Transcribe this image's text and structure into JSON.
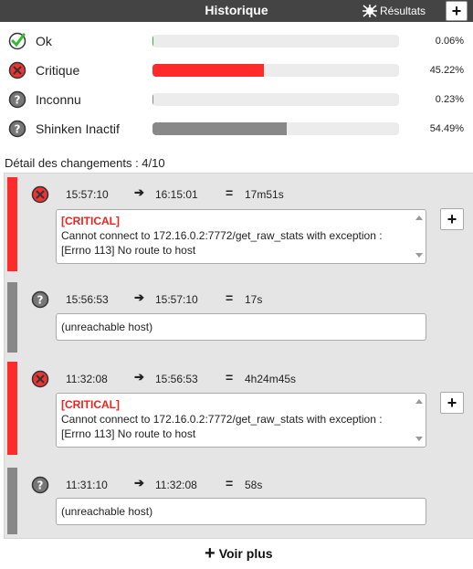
{
  "header": {
    "title": "Historique",
    "results_label": "Résultats",
    "plus_label": "+"
  },
  "stats": [
    {
      "label": "Ok",
      "percent": "0.06%",
      "fraction": 0.0006,
      "color": "#2fbd2f",
      "icon": "check-icon"
    },
    {
      "label": "Critique",
      "percent": "45.22%",
      "fraction": 0.4522,
      "color": "#ff2b2b",
      "icon": "critical-icon"
    },
    {
      "label": "Inconnu",
      "percent": "0.23%",
      "fraction": 0.0023,
      "color": "#888888",
      "icon": "unknown-icon"
    },
    {
      "label": "Shinken Inactif",
      "percent": "54.49%",
      "fraction": 0.5449,
      "color": "#888888",
      "icon": "unknown-icon"
    }
  ],
  "detail_title": "Détail des changements : 4/10",
  "changes": [
    {
      "status": "critical",
      "stripe": "#ff2b2b",
      "start": "15:57:10",
      "end": "16:15:01",
      "duration": "17m51s",
      "output_tag": "[CRITICAL]",
      "output_text": "Cannot connect to 172.16.0.2:7772/get_raw_stats with exception : [Errno 113] No route to host",
      "expand": "+"
    },
    {
      "status": "unknown",
      "stripe": "#888888",
      "start": "15:56:53",
      "end": "15:57:10",
      "duration": "17s",
      "output_tag": "",
      "output_text": "(unreachable host)",
      "expand": ""
    },
    {
      "status": "critical",
      "stripe": "#ff2b2b",
      "start": "11:32:08",
      "end": "15:56:53",
      "duration": "4h24m45s",
      "output_tag": "[CRITICAL]",
      "output_text": "Cannot connect to 172.16.0.2:7772/get_raw_stats with exception : [Errno 113] No route to host",
      "expand": "+"
    },
    {
      "status": "unknown",
      "stripe": "#888888",
      "start": "11:31:10",
      "end": "11:32:08",
      "duration": "58s",
      "output_tag": "",
      "output_text": "(unreachable host)",
      "expand": ""
    }
  ],
  "voir_plus": {
    "plus": "+",
    "label": "Voir plus"
  },
  "arrow_glyph": "➔",
  "equals_glyph": "="
}
